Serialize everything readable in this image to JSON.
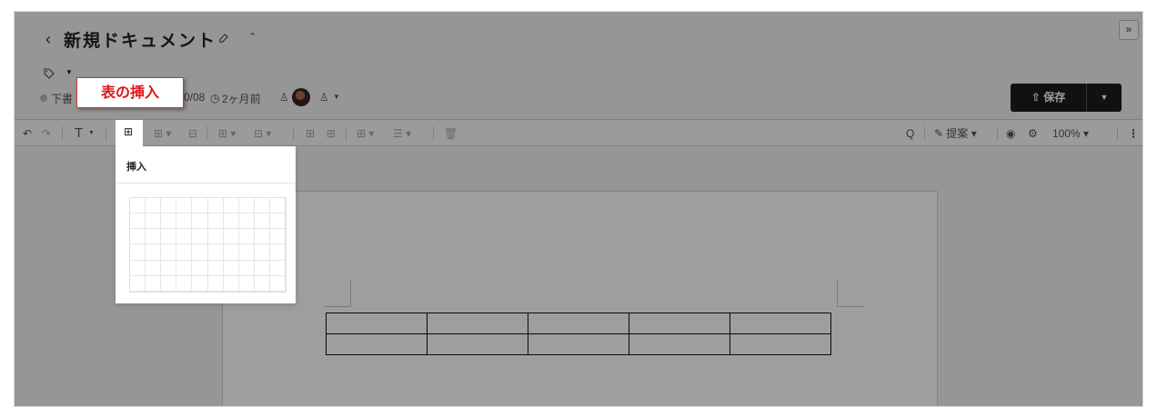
{
  "header": {
    "back_icon": "‹",
    "title": "新規ドキュメント",
    "expand_icon": "»",
    "collapse_icon": "⌃"
  },
  "meta": {
    "status": "下書",
    "date": "0/08",
    "relative_time": "2ヶ月前"
  },
  "save": {
    "label": "保存"
  },
  "toolbar": {
    "undo": "↶",
    "redo": "↷",
    "text_style": "T",
    "search": "Q",
    "suggest_label": "提案",
    "zoom": "100%",
    "more": "⋮"
  },
  "insert_popup": {
    "title": "挿入",
    "grid_cols": 10,
    "grid_rows": 6
  },
  "tooltip": {
    "label": "表の挿入"
  },
  "document_table": {
    "rows": 2,
    "cols": 5
  },
  "colors": {
    "overlay": "rgba(0,0,0,0.38)",
    "tooltip_text": "#e0161b",
    "save_bg": "#1c1c1c"
  }
}
